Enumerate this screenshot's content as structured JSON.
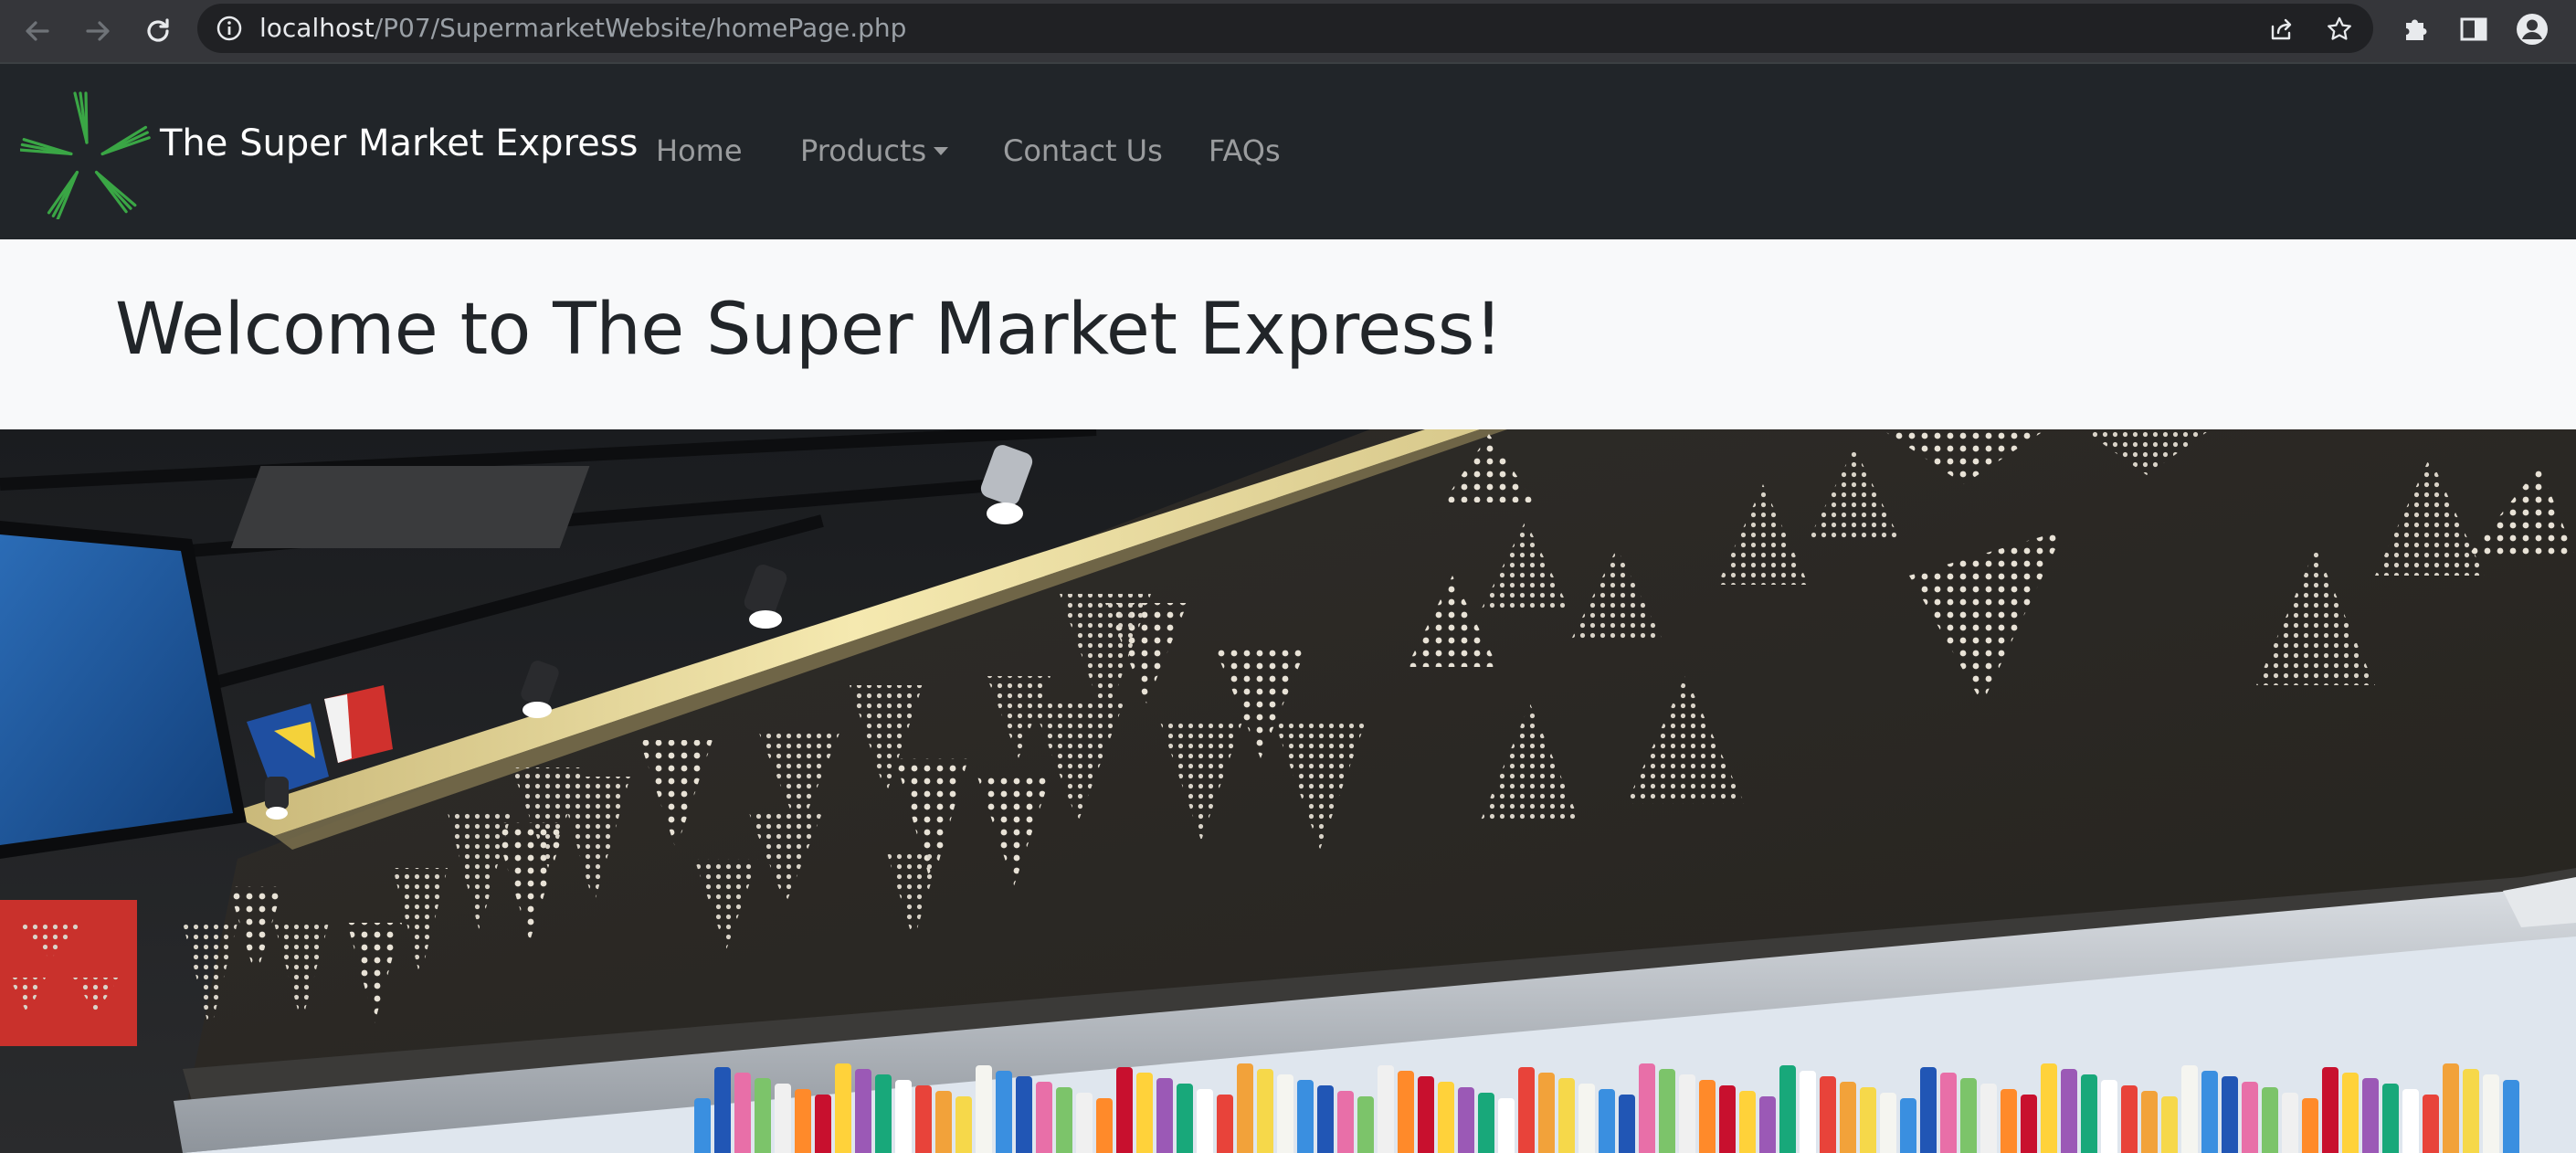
{
  "browser": {
    "url_host": "localhost",
    "url_path": "/P07/SupermarketWebsite/homePage.php",
    "icons": [
      "back-arrow-icon",
      "forward-arrow-icon",
      "reload-icon",
      "site-info-icon",
      "share-icon",
      "bookmark-star-icon",
      "extensions-puzzle-icon",
      "side-panel-icon",
      "profile-avatar-icon"
    ]
  },
  "navbar": {
    "brand": "The Super Market Express",
    "logo_icon": "green-star-logo-icon",
    "links": [
      {
        "label": "Home"
      },
      {
        "label": "Products",
        "dropdown": true
      },
      {
        "label": "Contact Us"
      },
      {
        "label": "FAQs"
      }
    ]
  },
  "welcome": {
    "heading": "Welcome to The Super Market Express!"
  },
  "hero": {
    "image": "supermarket-interior-photo",
    "colors": {
      "wall": "#2b2926",
      "dots": "#e8e2d6",
      "light_strip": "#f3e6a8",
      "red_wall": "#c9312c"
    }
  }
}
